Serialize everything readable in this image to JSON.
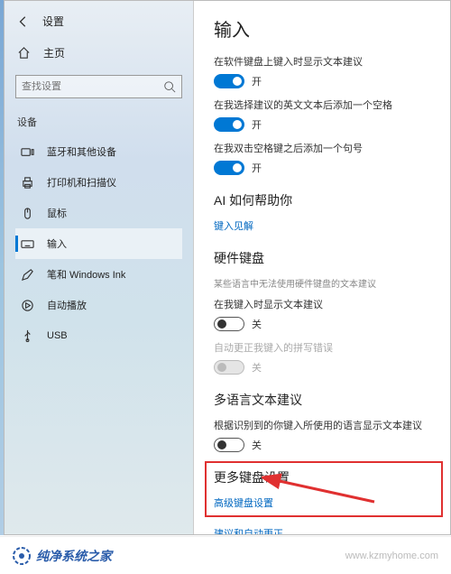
{
  "header": {
    "title": "设置"
  },
  "home": {
    "label": "主页"
  },
  "search": {
    "placeholder": "查找设置"
  },
  "category": "设备",
  "nav": [
    {
      "label": "蓝牙和其他设备"
    },
    {
      "label": "打印机和扫描仪"
    },
    {
      "label": "鼠标"
    },
    {
      "label": "输入"
    },
    {
      "label": "笔和 Windows Ink"
    },
    {
      "label": "自动播放"
    },
    {
      "label": "USB"
    }
  ],
  "main": {
    "title": "输入",
    "sec1": {
      "opt1": {
        "label": "在软件键盘上键入时显示文本建议",
        "state": "开"
      },
      "opt2": {
        "label": "在我选择建议的英文文本后添加一个空格",
        "state": "开"
      },
      "opt3": {
        "label": "在我双击空格键之后添加一个句号",
        "state": "开"
      }
    },
    "sec2": {
      "title": "AI 如何帮助你",
      "link": "键入见解"
    },
    "sec3": {
      "title": "硬件键盘",
      "sub": "某些语言中无法使用硬件键盘的文本建议",
      "opt1": {
        "label": "在我键入时显示文本建议",
        "state": "关"
      },
      "opt2": {
        "label": "自动更正我键入的拼写错误",
        "state": "关"
      }
    },
    "sec4": {
      "title": "多语言文本建议",
      "opt1": {
        "label": "根据识别到的你键入所使用的语言显示文本建议",
        "state": "关"
      }
    },
    "sec5": {
      "title": "更多键盘设置",
      "link": "高级键盘设置"
    },
    "link2": "建议和自动更正"
  },
  "footer": {
    "brand": "纯净系统之家",
    "url": "www.kzmyhome.com"
  }
}
